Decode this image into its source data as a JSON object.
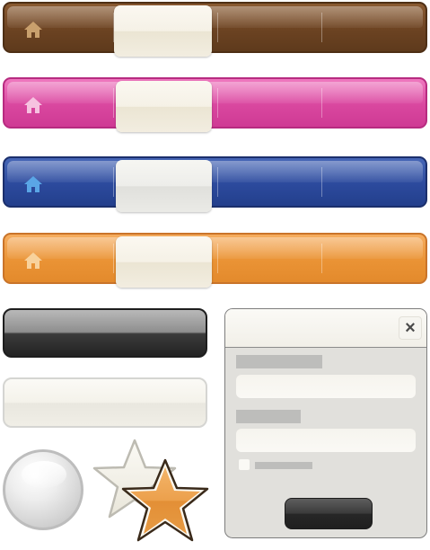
{
  "navbars": [
    {
      "id": "brown",
      "color": "#6c4322",
      "home_icon_color": "#c9a06d",
      "home_icon": "home-icon"
    },
    {
      "id": "pink",
      "color": "#d9479f",
      "home_icon_color": "#f6c2e0",
      "home_icon": "home-icon"
    },
    {
      "id": "blue",
      "color": "#2c4a9d",
      "home_icon_color": "#5aa6e6",
      "home_icon": "home-icon"
    },
    {
      "id": "orange",
      "color": "#ea9335",
      "home_icon_color": "#f8d29c",
      "home_icon": "home-icon"
    }
  ],
  "buttons": {
    "dark_pill_color": "#2b2b2b",
    "light_pill_color": "#f3f1ea"
  },
  "stars": {
    "back_star_color": "#f4f2ea",
    "front_star_color": "#e69a43"
  },
  "dialog": {
    "close_label": "×",
    "close_icon": "close-icon",
    "submit_color": "#2b2b2b"
  }
}
